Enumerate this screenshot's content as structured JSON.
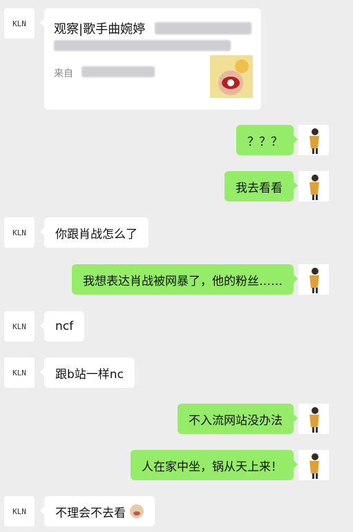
{
  "chat": {
    "contact_avatar_text": "KLN",
    "link_card": {
      "title": "观察|歌手曲婉婷",
      "source_label": "来自"
    },
    "messages": [
      {
        "side": "right",
        "text": "？？？"
      },
      {
        "side": "right",
        "text": "我去看看"
      },
      {
        "side": "left",
        "text": "你跟肖战怎么了"
      },
      {
        "side": "right",
        "text": "我想表达肖战被网暴了，他的粉丝……"
      },
      {
        "side": "left",
        "text": "ncf"
      },
      {
        "side": "left",
        "text": "跟b站一样nc"
      },
      {
        "side": "right",
        "text": "不入流网站没办法"
      },
      {
        "side": "right",
        "text": "人在家中坐，锅从天上来！"
      },
      {
        "side": "left",
        "text": "不理会不去看"
      }
    ]
  },
  "colors": {
    "background": "#ededed",
    "outgoing_bubble": "#95ec69",
    "incoming_bubble": "#ffffff"
  }
}
